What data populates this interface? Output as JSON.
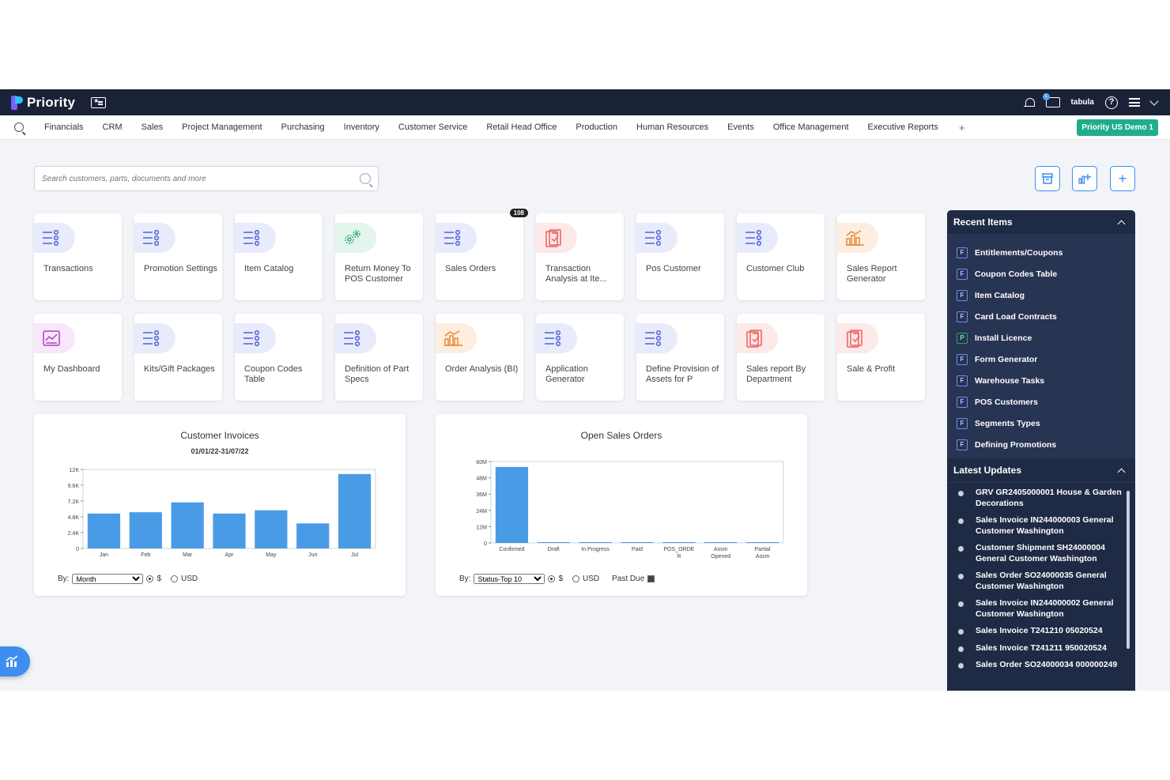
{
  "app": {
    "name": "Priority",
    "user": "tabula",
    "msg_count": "1"
  },
  "nav": {
    "items": [
      "Financials",
      "CRM",
      "Sales",
      "Project Management",
      "Purchasing",
      "Inventory",
      "Customer Service",
      "Retail Head Office",
      "Production",
      "Human Resources",
      "Events",
      "Office Management",
      "Executive Reports"
    ],
    "plus": "+",
    "company": "Priority US Demo 1"
  },
  "search": {
    "placeholder": "Search customers, parts, documents and more"
  },
  "tiles": [
    {
      "label": "Transactions",
      "icon": "list-icon",
      "color": "#5a6bd8",
      "bg": "#e8ebfb"
    },
    {
      "label": "Promotion Settings",
      "icon": "list-icon",
      "color": "#5a6bd8",
      "bg": "#e8ebfb"
    },
    {
      "label": "Item Catalog",
      "icon": "list-icon",
      "color": "#5a6bd8",
      "bg": "#e8ebfb"
    },
    {
      "label": "Return Money To POS Customer",
      "icon": "gears-icon",
      "color": "#2ca06a",
      "bg": "#e3f5ec"
    },
    {
      "label": "Sales Orders",
      "icon": "list-icon",
      "color": "#5a6bd8",
      "bg": "#e8ebfb",
      "count": "108"
    },
    {
      "label": "Transaction Analysis at Ite...",
      "icon": "report-icon",
      "color": "#e8615f",
      "bg": "#fde9e8"
    },
    {
      "label": "Pos Customer",
      "icon": "list-icon",
      "color": "#5a6bd8",
      "bg": "#e8ebfb"
    },
    {
      "label": "Customer Club",
      "icon": "list-icon",
      "color": "#5a6bd8",
      "bg": "#e8ebfb"
    },
    {
      "label": "Sales Report Generator",
      "icon": "bi-icon",
      "color": "#e58a3a",
      "bg": "#fdeedf"
    },
    {
      "label": "My Dashboard",
      "icon": "dashboard-icon",
      "color": "#b13fbf",
      "bg": "#f8e6fa"
    },
    {
      "label": "Kits/Gift Packages",
      "icon": "list-icon",
      "color": "#5a6bd8",
      "bg": "#e8ebfb"
    },
    {
      "label": "Coupon Codes Table",
      "icon": "list-icon",
      "color": "#5a6bd8",
      "bg": "#e8ebfb"
    },
    {
      "label": "Definition of Part Specs",
      "icon": "list-icon",
      "color": "#5a6bd8",
      "bg": "#e8ebfb"
    },
    {
      "label": "Order Analysis (BI)",
      "icon": "bi-icon",
      "color": "#e58a3a",
      "bg": "#fdeedf"
    },
    {
      "label": "Application Generator",
      "icon": "list-icon",
      "color": "#5a6bd8",
      "bg": "#e8ebfb"
    },
    {
      "label": "Define Provision of Assets for P",
      "icon": "list-icon",
      "color": "#5a6bd8",
      "bg": "#e8ebfb"
    },
    {
      "label": "Sales report By Department",
      "icon": "report-icon",
      "color": "#e8615f",
      "bg": "#fde9e8"
    },
    {
      "label": "Sale & Profit",
      "icon": "report-icon",
      "color": "#e8615f",
      "bg": "#fde9e8"
    }
  ],
  "chart1": {
    "title": "Customer Invoices",
    "subtitle": "01/01/22-31/07/22",
    "by_label": "By:",
    "select": "Month",
    "radio1": "$",
    "radio2": "USD"
  },
  "chart2": {
    "title": "Open Sales Orders",
    "by_label": "By:",
    "select": "Status-Top 10",
    "radio1": "$",
    "radio2": "USD",
    "past_due": "Past Due"
  },
  "chart_data": [
    {
      "type": "bar",
      "title": "Customer Invoices",
      "subtitle": "01/01/22-31/07/22",
      "categories": [
        "Jan",
        "Feb",
        "Mar",
        "Apr",
        "May",
        "Jun",
        "Jul"
      ],
      "values": [
        5300,
        5500,
        7000,
        5300,
        5800,
        3800,
        11300
      ],
      "yticks": [
        "0",
        "2.4K",
        "4.8K",
        "7.2K",
        "9.6K",
        "12K"
      ],
      "ylim": [
        0,
        12000
      ],
      "color": "#4a9be6"
    },
    {
      "type": "bar",
      "title": "Open Sales Orders",
      "categories": [
        "Confirmed",
        "Draft",
        "In Progress",
        "Paid",
        "POS_ORDE R",
        "Assm Opened",
        "Partial Assm"
      ],
      "values": [
        56000000,
        0,
        0,
        0,
        0,
        0,
        0
      ],
      "yticks": [
        "0",
        "12M",
        "24M",
        "36M",
        "48M",
        "60M"
      ],
      "ylim": [
        0,
        60000000
      ],
      "color": "#4a9be6"
    }
  ],
  "recent": {
    "title": "Recent Items",
    "items": [
      {
        "badge": "F",
        "label": "Entitlements/Coupons"
      },
      {
        "badge": "F",
        "label": "Coupon Codes Table"
      },
      {
        "badge": "F",
        "label": "Item Catalog"
      },
      {
        "badge": "F",
        "label": "Card Load Contracts"
      },
      {
        "badge": "P",
        "label": "Install Licence"
      },
      {
        "badge": "F",
        "label": "Form Generator"
      },
      {
        "badge": "F",
        "label": "Warehouse Tasks"
      },
      {
        "badge": "F",
        "label": "POS Customers"
      },
      {
        "badge": "F",
        "label": "Segments Types"
      },
      {
        "badge": "F",
        "label": "Defining Promotions"
      }
    ]
  },
  "updates": {
    "title": "Latest Updates",
    "items": [
      "GRV GR2405000001 House & Garden Decorations",
      "Sales Invoice IN244000003 General Customer Washington",
      "Customer Shipment SH24000004 General Customer Washington",
      "Sales Order SO24000035 General Customer Washington",
      "Sales Invoice IN244000002 General Customer Washington",
      "Sales Invoice T241210 05020524",
      "Sales Invoice T241211 950020524",
      "Sales Order SO24000034 000000249"
    ]
  }
}
